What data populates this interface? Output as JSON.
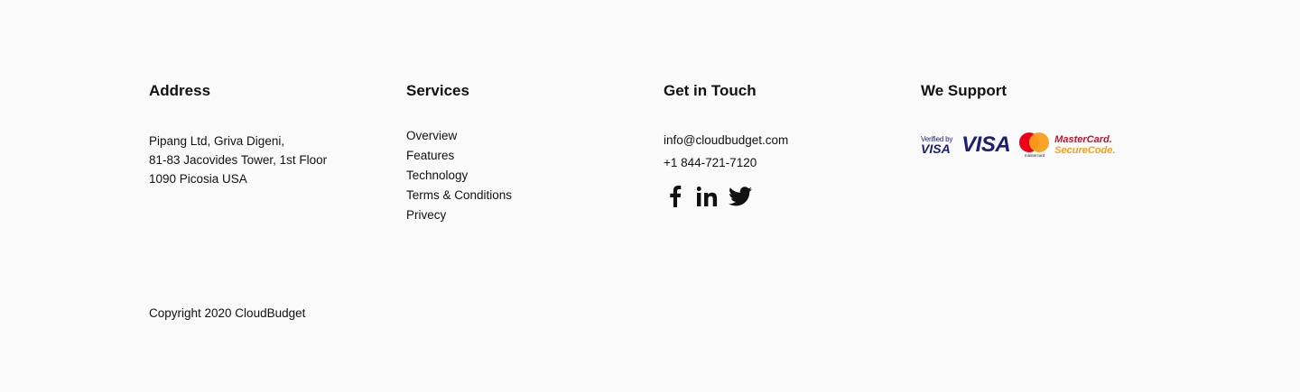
{
  "address": {
    "heading": "Address",
    "lines": [
      "Pipang Ltd, Griva Digeni,",
      "81-83 Jacovides Tower, 1st Floor",
      "1090 Picosia USA"
    ]
  },
  "services": {
    "heading": "Services",
    "items": [
      "Overview",
      "Features",
      "Technology",
      "Terms & Conditions",
      "Privecy"
    ]
  },
  "contact": {
    "heading": "Get in Touch",
    "email": "info@cloudbudget.com",
    "phone": "+1 844-721-7120",
    "social": [
      "facebook-icon",
      "linkedin-icon",
      "twitter-icon"
    ]
  },
  "support": {
    "heading": "We Support",
    "verified_by_top": "Verified by",
    "verified_by_bottom": "VISA",
    "visa": "VISA",
    "mastercard_mini": "mastercard",
    "mastercard_line1": "MasterCard.",
    "mastercard_line2": "SecureCode."
  },
  "copyright": "Copyright 2020 CloudBudget",
  "colors": {
    "background": "#fafafa",
    "text": "#111111",
    "visa_blue": "#1a1f71",
    "mc_red": "#eb001b",
    "mc_orange": "#f79e1b"
  }
}
